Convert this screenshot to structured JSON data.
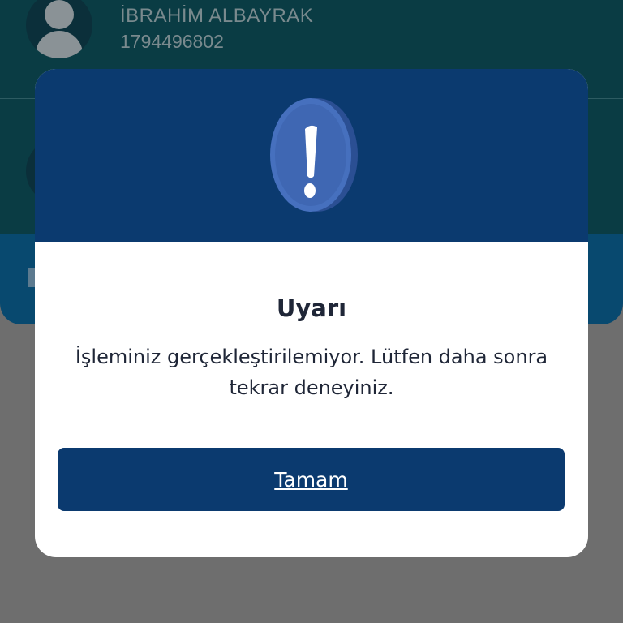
{
  "background": {
    "contact": {
      "name": "İBRAHİM ALBAYRAK",
      "number": "1794496802"
    }
  },
  "dialog": {
    "icon": "exclamation-icon",
    "title": "Uyarı",
    "message": "İşleminiz gerçekleştirilemiyor. Lütfen daha sonra tekrar deneyiniz.",
    "ok_label": "Tamam"
  },
  "colors": {
    "header": "#0b3a6f",
    "button": "#0b3a6f",
    "overlay": "#6e6e6e",
    "text": "#1f2637"
  }
}
